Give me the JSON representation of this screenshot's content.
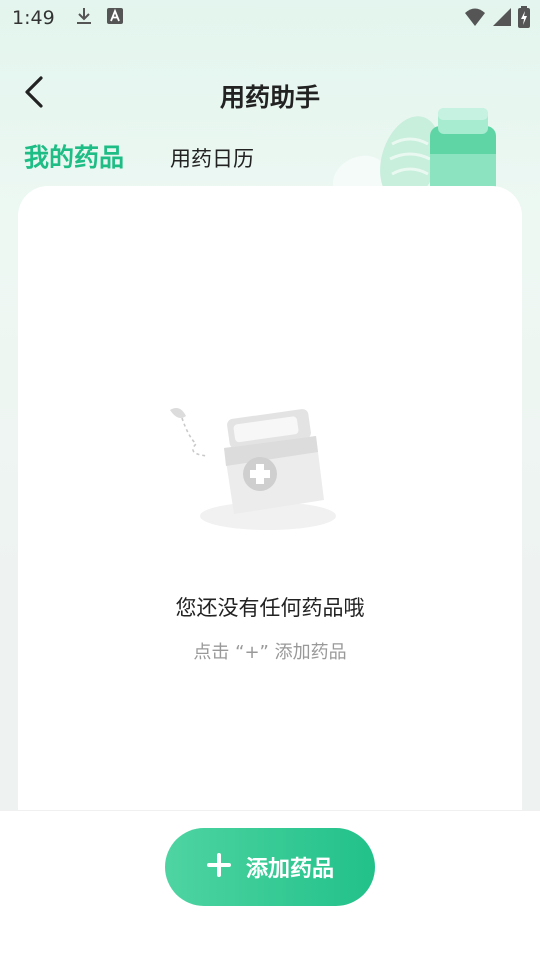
{
  "status_bar": {
    "time": "1:49",
    "icons": [
      "download-icon",
      "a-app-icon",
      "wifi-icon",
      "signal-icon",
      "battery-icon"
    ]
  },
  "header": {
    "title": "用药助手",
    "back_icon": "chevron-left-icon"
  },
  "tabs": [
    {
      "label": "我的药品",
      "active": true
    },
    {
      "label": "用药日历",
      "active": false
    }
  ],
  "empty_state": {
    "title": "您还没有任何药品哦",
    "hint": "点击 “+” 添加药品",
    "illustration": "medicine-box-icon"
  },
  "add_button": {
    "label": "添加药品",
    "icon": "plus-icon"
  },
  "colors": {
    "accent": "#1fbd86",
    "button_start": "#4ed4a2",
    "button_end": "#22c18a",
    "background": "#eef3f1"
  }
}
